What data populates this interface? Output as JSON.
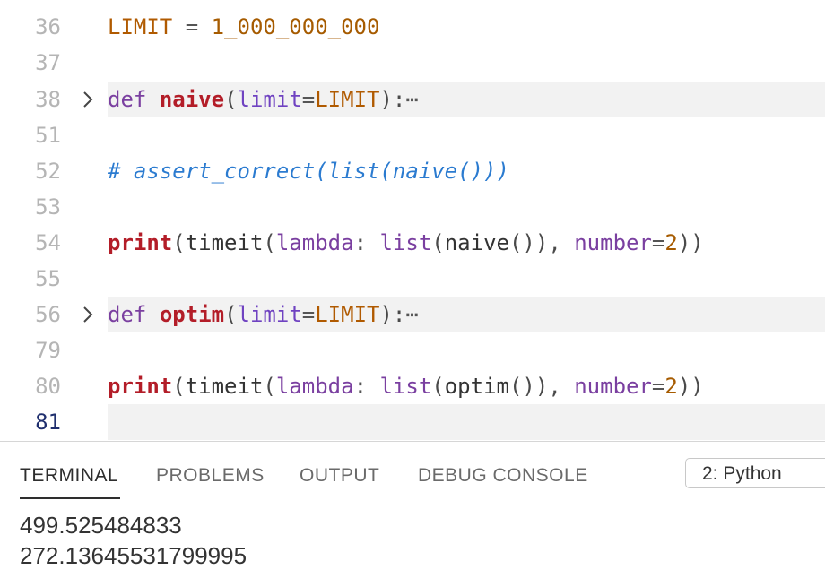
{
  "editor": {
    "lines": [
      {
        "num": "36",
        "text": "LIMIT = 1_000_000_000"
      },
      {
        "num": "37",
        "text": ""
      },
      {
        "num": "38",
        "text": "def naive(limit=LIMIT):⋯"
      },
      {
        "num": "51",
        "text": ""
      },
      {
        "num": "52",
        "text": "# assert_correct(list(naive()))"
      },
      {
        "num": "53",
        "text": ""
      },
      {
        "num": "54",
        "text": "print(timeit(lambda: list(naive()), number=2))"
      },
      {
        "num": "55",
        "text": ""
      },
      {
        "num": "56",
        "text": "def optim(limit=LIMIT):⋯"
      },
      {
        "num": "79",
        "text": ""
      },
      {
        "num": "80",
        "text": "print(timeit(lambda: list(optim()), number=2))"
      },
      {
        "num": "81",
        "text": ""
      }
    ],
    "tokens": {
      "limit_const": "LIMIT",
      "eq": " = ",
      "limit_value": "1_000_000_000",
      "def": "def",
      "naive": "naive",
      "optim": "optim",
      "param": "limit",
      "param_eq": "=",
      "ellipsis": "⋯",
      "comment": "# assert_correct(list(naive()))",
      "print": "print",
      "timeit": "timeit",
      "lambda": "lambda",
      "list": "list",
      "number": "number",
      "two": "2"
    }
  },
  "panel": {
    "tabs": [
      "TERMINAL",
      "PROBLEMS",
      "OUTPUT",
      "DEBUG CONSOLE"
    ],
    "terminal_select": "2: Python",
    "output": [
      "499.525484833",
      "272.13645531799995"
    ]
  },
  "colors": {
    "comment": "#2b7bd0",
    "keyword": "#7a3fa0",
    "function": "#b31d28",
    "constant": "#b05a00"
  }
}
